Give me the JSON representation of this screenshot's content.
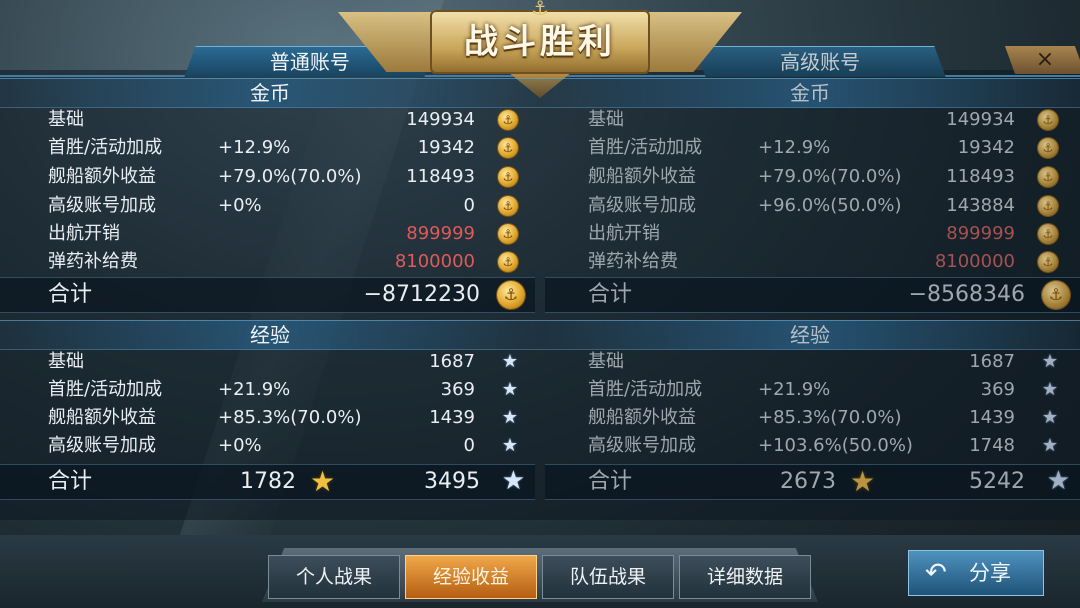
{
  "title": "战斗胜利",
  "close_label": "×",
  "accounts": [
    {
      "name": "普通账号",
      "gold": {
        "header": "金币",
        "rows": [
          {
            "label": "基础",
            "pct": "",
            "value": "149934"
          },
          {
            "label": "首胜/活动加成",
            "pct": "+12.9%",
            "value": "19342"
          },
          {
            "label": "舰船额外收益",
            "pct": "+79.0%(70.0%)",
            "value": "118493"
          },
          {
            "label": "高级账号加成",
            "pct": "+0%",
            "value": "0"
          },
          {
            "label": "出航开销",
            "pct": "",
            "value": "899999"
          },
          {
            "label": "弹药补给费",
            "pct": "",
            "value": "8100000"
          }
        ],
        "total_label": "合计",
        "total_value": "−8712230"
      },
      "exp": {
        "header": "经验",
        "rows": [
          {
            "label": "基础",
            "pct": "",
            "value": "1687"
          },
          {
            "label": "首胜/活动加成",
            "pct": "+21.9%",
            "value": "369"
          },
          {
            "label": "舰船额外收益",
            "pct": "+85.3%(70.0%)",
            "value": "1439"
          },
          {
            "label": "高级账号加成",
            "pct": "+0%",
            "value": "0"
          }
        ],
        "total_label": "合计",
        "captain_value": "1782",
        "total_value": "3495"
      }
    },
    {
      "name": "高级账号",
      "gold": {
        "header": "金币",
        "rows": [
          {
            "label": "基础",
            "pct": "",
            "value": "149934"
          },
          {
            "label": "首胜/活动加成",
            "pct": "+12.9%",
            "value": "19342"
          },
          {
            "label": "舰船额外收益",
            "pct": "+79.0%(70.0%)",
            "value": "118493"
          },
          {
            "label": "高级账号加成",
            "pct": "+96.0%(50.0%)",
            "value": "143884"
          },
          {
            "label": "出航开销",
            "pct": "",
            "value": "899999"
          },
          {
            "label": "弹药补给费",
            "pct": "",
            "value": "8100000"
          }
        ],
        "total_label": "合计",
        "total_value": "−8568346"
      },
      "exp": {
        "header": "经验",
        "rows": [
          {
            "label": "基础",
            "pct": "",
            "value": "1687"
          },
          {
            "label": "首胜/活动加成",
            "pct": "+21.9%",
            "value": "369"
          },
          {
            "label": "舰船额外收益",
            "pct": "+85.3%(70.0%)",
            "value": "1439"
          },
          {
            "label": "高级账号加成",
            "pct": "+103.6%(50.0%)",
            "value": "1748"
          }
        ],
        "total_label": "合计",
        "captain_value": "2673",
        "total_value": "5242"
      }
    }
  ],
  "tabs": [
    {
      "label": "个人战果",
      "active": false
    },
    {
      "label": "经验收益",
      "active": true
    },
    {
      "label": "队伍战果",
      "active": false
    },
    {
      "label": "详细数据",
      "active": false
    }
  ],
  "share_label": "分享",
  "icons": {
    "gold": "gold-coin-icon",
    "exp": "star-icon",
    "captain_exp": "gold-star-icon",
    "share": "return-arrow-icon",
    "close": "close-icon"
  },
  "colors": {
    "cost_text": "#e05a5a",
    "active_tab": "#e08a2a",
    "panel_accent": "#3f7ea6"
  }
}
